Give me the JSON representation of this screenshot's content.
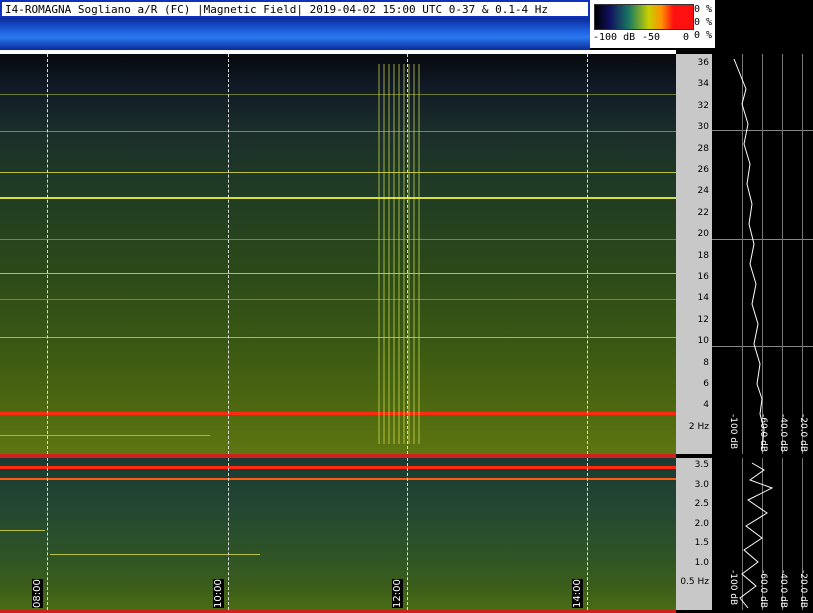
{
  "header": {
    "title": "I4-ROMAGNA  Sogliano a/R (FC) |Magnetic Field| 2019-04-02 15:00 UTC 0-37 & 0.1-4 Hz"
  },
  "colorbar": {
    "label_min": "-100 dB",
    "label_mid": "-50",
    "label_max": "0",
    "pct1": "0 %",
    "pct2": "0 %",
    "pct3": "0 %"
  },
  "axis_top": {
    "ticks": [
      "36",
      "34",
      "32",
      "30",
      "28",
      "26",
      "24",
      "22",
      "20",
      "18",
      "16",
      "14",
      "12",
      "10",
      "8",
      "6",
      "4",
      "2 Hz"
    ]
  },
  "axis_bot": {
    "ticks": [
      "3.5",
      "3.0",
      "2.5",
      "2.0",
      "1.5",
      "1.0",
      "0.5 Hz"
    ]
  },
  "profile": {
    "db_labels": [
      "-100 dB",
      "-60.0 dB",
      "-40.0 dB",
      "-20.0 dB"
    ]
  },
  "time_labels": [
    "08:00",
    "10:00",
    "12:00",
    "14:00"
  ],
  "colors": {
    "line_red": "#ff2a10",
    "line_yellow": "#d8e040",
    "frame_blue": "#1030c0"
  }
}
